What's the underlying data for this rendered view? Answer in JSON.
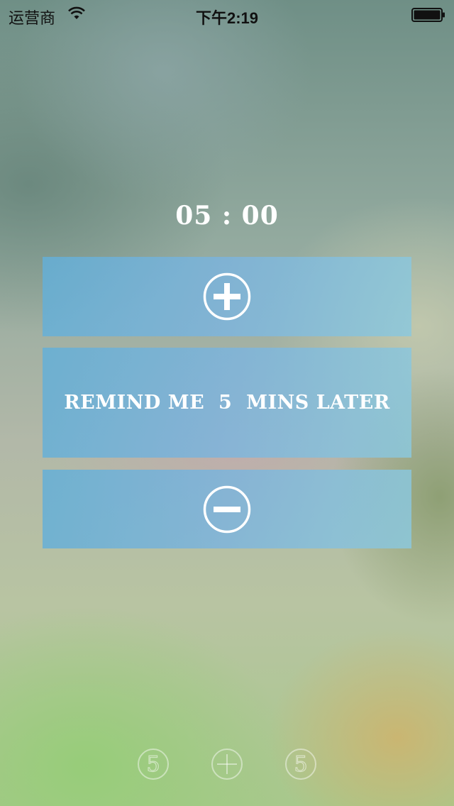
{
  "status_bar": {
    "carrier": "运营商",
    "time": "下午2:19",
    "icons": [
      "wifi-icon",
      "battery-icon"
    ]
  },
  "timer": {
    "display": "05 : 00"
  },
  "controls": {
    "increase_icon": "plus-circle-icon",
    "remind_label": "REMIND ME  5  MINS LATER",
    "decrease_icon": "minus-circle-icon"
  },
  "dock": {
    "left_digit": "5",
    "middle_icon": "plus-circle-icon",
    "right_digit": "5"
  },
  "colors": {
    "panel": "#7fb8d8",
    "text": "#ffffff"
  }
}
